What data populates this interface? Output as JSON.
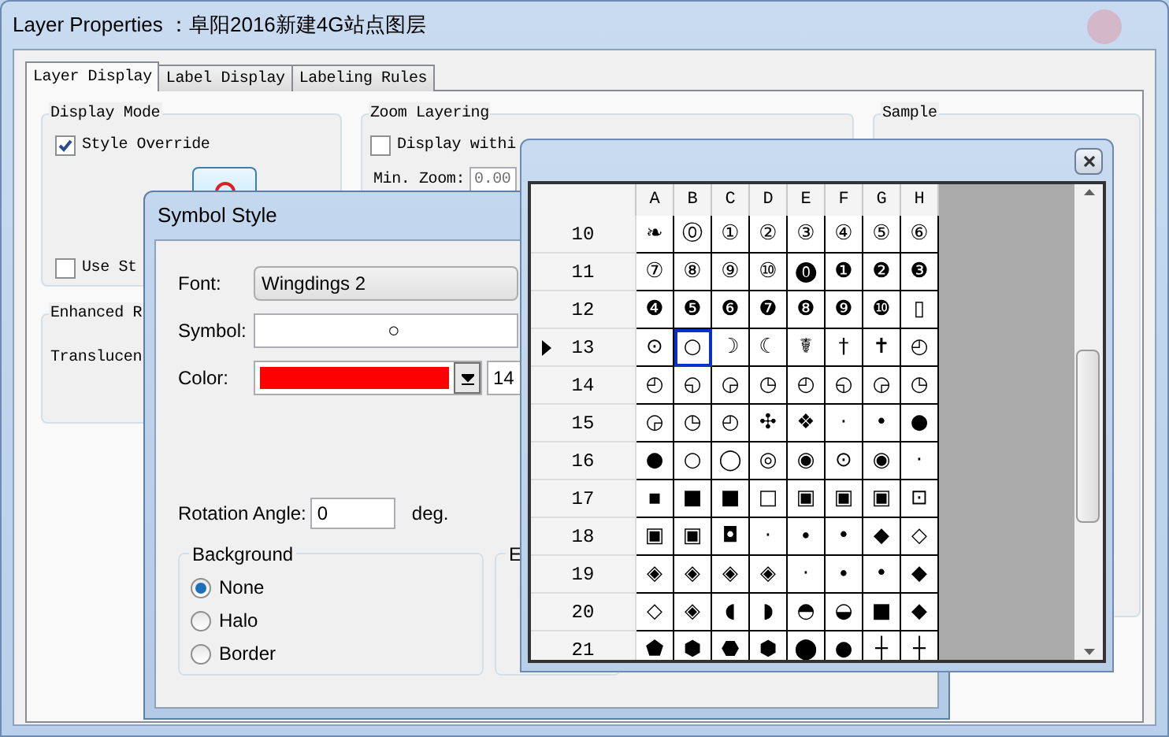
{
  "window": {
    "title": "Layer Properties ：阜阳2016新建4G站点图层"
  },
  "tabs": [
    {
      "label": "Layer Display",
      "selected": true
    },
    {
      "label": "Label Display",
      "selected": false
    },
    {
      "label": "Labeling Rules",
      "selected": false
    }
  ],
  "display_mode": {
    "title": "Display Mode",
    "style_override": {
      "label": "Style Override",
      "checked": true
    },
    "use_style": {
      "label": "Use St",
      "checked": false
    }
  },
  "zoom_layering": {
    "title": "Zoom Layering",
    "display_within": {
      "label": "Display withi",
      "checked": false
    },
    "min_zoom": {
      "label": "Min. Zoom:",
      "value": "0.00"
    }
  },
  "enhanced": {
    "title": "Enhanced R",
    "translucency_label": "Translucen"
  },
  "sample": {
    "title": "Sample"
  },
  "symbol_style": {
    "title": "Symbol Style",
    "font": {
      "label": "Font:",
      "value": "Wingdings 2"
    },
    "symbol": {
      "label": "Symbol:",
      "value": "○"
    },
    "color": {
      "label": "Color:",
      "color": "#ff0000",
      "size": "14"
    },
    "rotation": {
      "label": "Rotation Angle:",
      "value": "0",
      "unit": "deg."
    },
    "background": {
      "title": "Background",
      "options": [
        {
          "label": "None",
          "selected": true
        },
        {
          "label": "Halo",
          "selected": false
        },
        {
          "label": "Border",
          "selected": false
        }
      ]
    },
    "effects_title": "E"
  },
  "symbol_grid": {
    "columns": [
      "A",
      "B",
      "C",
      "D",
      "E",
      "F",
      "G",
      "H"
    ],
    "rows": [
      {
        "number": "10",
        "current": false,
        "cells": [
          {
            "g": "❧",
            "selected": false
          },
          {
            "g": "⓪",
            "selected": false
          },
          {
            "g": "①",
            "selected": false
          },
          {
            "g": "②",
            "selected": false
          },
          {
            "g": "③",
            "selected": false
          },
          {
            "g": "④",
            "selected": false
          },
          {
            "g": "⑤",
            "selected": false
          },
          {
            "g": "⑥",
            "selected": false
          }
        ]
      },
      {
        "number": "11",
        "current": false,
        "cells": [
          {
            "g": "⑦",
            "selected": false
          },
          {
            "g": "⑧",
            "selected": false
          },
          {
            "g": "⑨",
            "selected": false
          },
          {
            "g": "⑩",
            "selected": false
          },
          {
            "g": "⓿",
            "selected": false
          },
          {
            "g": "❶",
            "selected": false
          },
          {
            "g": "❷",
            "selected": false
          },
          {
            "g": "❸",
            "selected": false
          }
        ]
      },
      {
        "number": "12",
        "current": false,
        "cells": [
          {
            "g": "❹",
            "selected": false
          },
          {
            "g": "❺",
            "selected": false
          },
          {
            "g": "❻",
            "selected": false
          },
          {
            "g": "❼",
            "selected": false
          },
          {
            "g": "❽",
            "selected": false
          },
          {
            "g": "❾",
            "selected": false
          },
          {
            "g": "❿",
            "selected": false
          },
          {
            "g": "▯",
            "selected": false
          }
        ]
      },
      {
        "number": "13",
        "current": true,
        "cells": [
          {
            "g": "⊙",
            "selected": false
          },
          {
            "g": "○",
            "selected": true
          },
          {
            "g": "☽",
            "selected": false
          },
          {
            "g": "☾",
            "selected": false
          },
          {
            "g": "☤",
            "selected": false
          },
          {
            "g": "†",
            "selected": false
          },
          {
            "g": "✝",
            "selected": false
          },
          {
            "g": "◴",
            "selected": false
          }
        ]
      },
      {
        "number": "14",
        "current": false,
        "cells": [
          {
            "g": "◴",
            "selected": false
          },
          {
            "g": "◵",
            "selected": false
          },
          {
            "g": "◶",
            "selected": false
          },
          {
            "g": "◷",
            "selected": false
          },
          {
            "g": "◴",
            "selected": false
          },
          {
            "g": "◵",
            "selected": false
          },
          {
            "g": "◶",
            "selected": false
          },
          {
            "g": "◷",
            "selected": false
          }
        ]
      },
      {
        "number": "15",
        "current": false,
        "cells": [
          {
            "g": "◶",
            "selected": false
          },
          {
            "g": "◷",
            "selected": false
          },
          {
            "g": "◴",
            "selected": false
          },
          {
            "g": "✣",
            "selected": false
          },
          {
            "g": "❖",
            "selected": false
          },
          {
            "g": "·",
            "selected": false
          },
          {
            "g": "•",
            "selected": false
          },
          {
            "g": "●",
            "selected": false
          }
        ]
      },
      {
        "number": "16",
        "current": false,
        "cells": [
          {
            "g": "●",
            "selected": false
          },
          {
            "g": "○",
            "selected": false
          },
          {
            "g": "◯",
            "selected": false
          },
          {
            "g": "◎",
            "selected": false
          },
          {
            "g": "◉",
            "selected": false
          },
          {
            "g": "⊙",
            "selected": false
          },
          {
            "g": "◉",
            "selected": false
          },
          {
            "g": "·",
            "selected": false
          }
        ]
      },
      {
        "number": "17",
        "current": false,
        "cells": [
          {
            "g": "▪",
            "selected": false
          },
          {
            "g": "■",
            "selected": false
          },
          {
            "g": "■",
            "selected": false
          },
          {
            "g": "□",
            "selected": false
          },
          {
            "g": "▣",
            "selected": false
          },
          {
            "g": "▣",
            "selected": false
          },
          {
            "g": "▣",
            "selected": false
          },
          {
            "g": "⊡",
            "selected": false
          }
        ]
      },
      {
        "number": "18",
        "current": false,
        "cells": [
          {
            "g": "▣",
            "selected": false
          },
          {
            "g": "▣",
            "selected": false
          },
          {
            "g": "◘",
            "selected": false
          },
          {
            "g": "·",
            "selected": false
          },
          {
            "g": "∙",
            "selected": false
          },
          {
            "g": "•",
            "selected": false
          },
          {
            "g": "◆",
            "selected": false
          },
          {
            "g": "◇",
            "selected": false
          }
        ]
      },
      {
        "number": "19",
        "current": false,
        "cells": [
          {
            "g": "◈",
            "selected": false
          },
          {
            "g": "◈",
            "selected": false
          },
          {
            "g": "◈",
            "selected": false
          },
          {
            "g": "◈",
            "selected": false
          },
          {
            "g": "·",
            "selected": false
          },
          {
            "g": "∙",
            "selected": false
          },
          {
            "g": "•",
            "selected": false
          },
          {
            "g": "◆",
            "selected": false
          }
        ]
      },
      {
        "number": "20",
        "current": false,
        "cells": [
          {
            "g": "◇",
            "selected": false
          },
          {
            "g": "◈",
            "selected": false
          },
          {
            "g": "◖",
            "selected": false
          },
          {
            "g": "◗",
            "selected": false
          },
          {
            "g": "◓",
            "selected": false
          },
          {
            "g": "◒",
            "selected": false
          },
          {
            "g": "■",
            "selected": false
          },
          {
            "g": "◆",
            "selected": false
          }
        ]
      },
      {
        "number": "21",
        "current": false,
        "cells": [
          {
            "g": "⬟",
            "selected": false
          },
          {
            "g": "⬢",
            "selected": false
          },
          {
            "g": "⬣",
            "selected": false
          },
          {
            "g": "⬢",
            "selected": false
          },
          {
            "g": "⬤",
            "selected": false
          },
          {
            "g": "●",
            "selected": false
          },
          {
            "g": "┼",
            "selected": false
          },
          {
            "g": "┼",
            "selected": false
          }
        ]
      }
    ]
  }
}
